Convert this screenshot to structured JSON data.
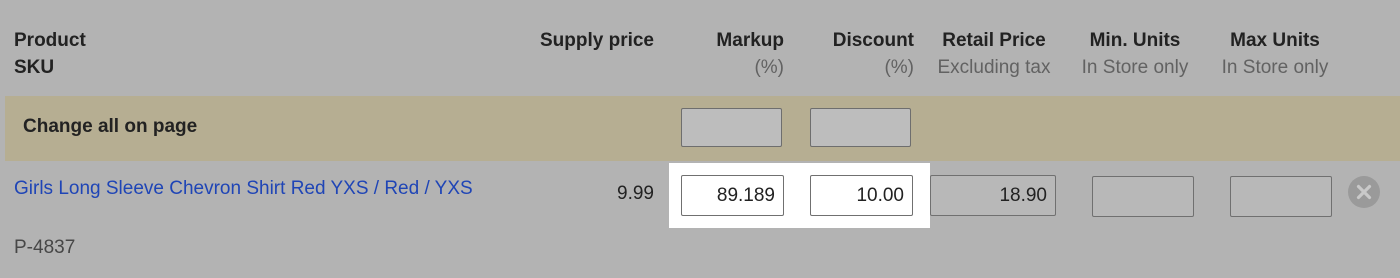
{
  "headers": {
    "product": "Product",
    "sku": "SKU",
    "supply_price": "Supply price",
    "markup": "Markup",
    "markup_unit": "(%)",
    "discount": "Discount",
    "discount_unit": "(%)",
    "retail_price": "Retail Price",
    "retail_price_sub": "Excluding tax",
    "min_units": "Min. Units",
    "min_units_sub": "In Store only",
    "max_units": "Max Units",
    "max_units_sub": "In Store only"
  },
  "change_all": {
    "label": "Change all on page",
    "markup_value": "",
    "discount_value": ""
  },
  "row": {
    "product_name": "Girls Long Sleeve Chevron Shirt Red YXS / Red / YXS",
    "sku": "P-4837",
    "supply_price": "9.99",
    "markup": "89.189",
    "discount": "10.00",
    "retail_price": "18.90",
    "min_units": "",
    "max_units": ""
  },
  "icons": {
    "remove": "close-circle-icon"
  }
}
